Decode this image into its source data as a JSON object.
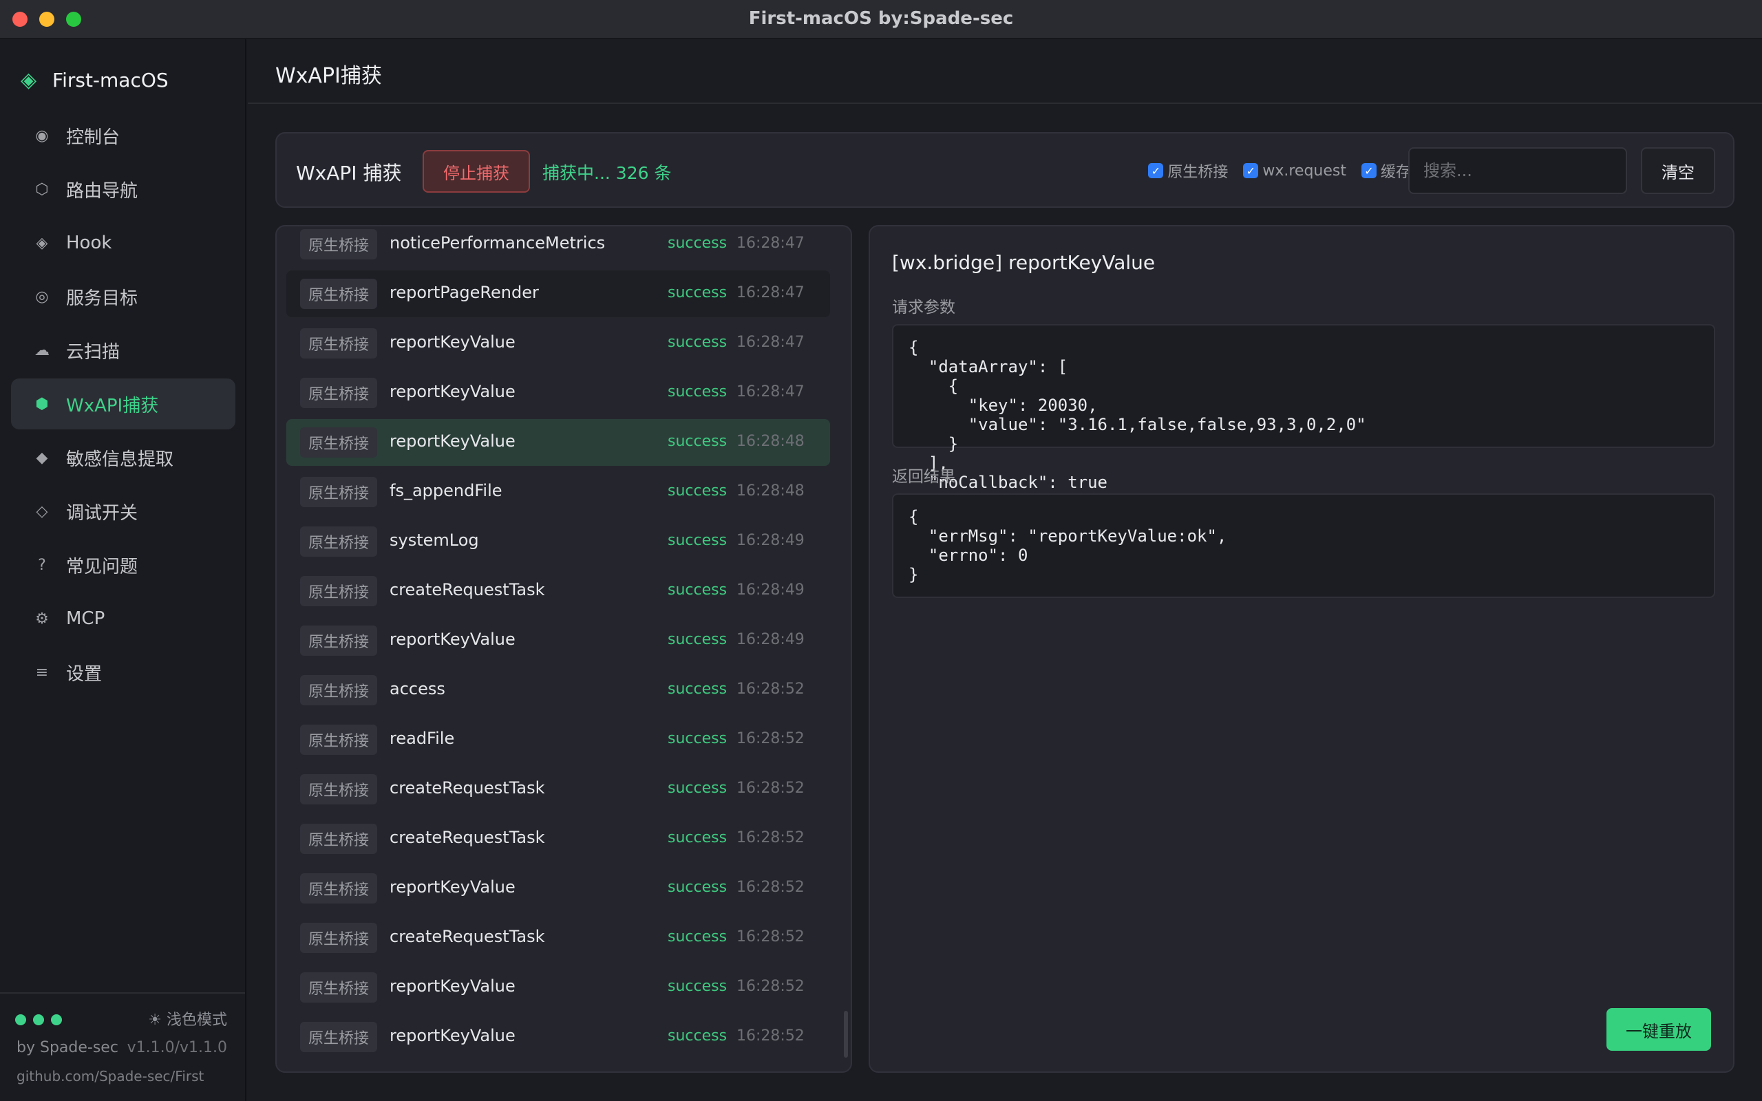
{
  "window": {
    "title": "First-macOS  by:Spade-sec"
  },
  "sidebar": {
    "brand": "First-macOS",
    "items": [
      {
        "label": "控制台",
        "icon": "◉",
        "name": "console"
      },
      {
        "label": "路由导航",
        "icon": "⬡",
        "name": "route-nav"
      },
      {
        "label": "Hook",
        "icon": "◈",
        "name": "hook"
      },
      {
        "label": "服务目标",
        "icon": "◎",
        "name": "service-target"
      },
      {
        "label": "云扫描",
        "icon": "☁",
        "name": "cloud-scan"
      },
      {
        "label": "WxAPI捕获",
        "icon": "⬢",
        "name": "wxapi-capture"
      },
      {
        "label": "敏感信息提取",
        "icon": "◆",
        "name": "sensitive-extract"
      },
      {
        "label": "调试开关",
        "icon": "◇",
        "name": "debug-switch"
      },
      {
        "label": "常见问题",
        "icon": "?",
        "name": "faq"
      },
      {
        "label": "MCP",
        "icon": "⚙",
        "name": "mcp"
      },
      {
        "label": "设置",
        "icon": "≡",
        "name": "settings"
      }
    ],
    "active_index": 5,
    "footer": {
      "theme_toggle": "☀ 浅色模式",
      "by": "by Spade-sec",
      "version": "v1.1.0/v1.1.0",
      "repo": "github.com/Spade-sec/First"
    }
  },
  "header": {
    "title": "WxAPI捕获"
  },
  "toolbar": {
    "title": "WxAPI 捕获",
    "stop_label": "停止捕获",
    "status": "捕获中... 326 条",
    "filters": [
      "原生桥接",
      "wx.request",
      "缓存"
    ],
    "search_placeholder": "搜索...",
    "clear_label": "清空"
  },
  "list": {
    "rows": [
      {
        "tag": "原生桥接",
        "name": "noticePerformanceMetrics",
        "status": "success",
        "time": "16:28:47"
      },
      {
        "tag": "原生桥接",
        "name": "reportPageRender",
        "status": "success",
        "time": "16:28:47"
      },
      {
        "tag": "原生桥接",
        "name": "reportKeyValue",
        "status": "success",
        "time": "16:28:47"
      },
      {
        "tag": "原生桥接",
        "name": "reportKeyValue",
        "status": "success",
        "time": "16:28:47"
      },
      {
        "tag": "原生桥接",
        "name": "reportKeyValue",
        "status": "success",
        "time": "16:28:48"
      },
      {
        "tag": "原生桥接",
        "name": "fs_appendFile",
        "status": "success",
        "time": "16:28:48"
      },
      {
        "tag": "原生桥接",
        "name": "systemLog",
        "status": "success",
        "time": "16:28:49"
      },
      {
        "tag": "原生桥接",
        "name": "createRequestTask",
        "status": "success",
        "time": "16:28:49"
      },
      {
        "tag": "原生桥接",
        "name": "reportKeyValue",
        "status": "success",
        "time": "16:28:49"
      },
      {
        "tag": "原生桥接",
        "name": "access",
        "status": "success",
        "time": "16:28:52"
      },
      {
        "tag": "原生桥接",
        "name": "readFile",
        "status": "success",
        "time": "16:28:52"
      },
      {
        "tag": "原生桥接",
        "name": "createRequestTask",
        "status": "success",
        "time": "16:28:52"
      },
      {
        "tag": "原生桥接",
        "name": "createRequestTask",
        "status": "success",
        "time": "16:28:52"
      },
      {
        "tag": "原生桥接",
        "name": "reportKeyValue",
        "status": "success",
        "time": "16:28:52"
      },
      {
        "tag": "原生桥接",
        "name": "createRequestTask",
        "status": "success",
        "time": "16:28:52"
      },
      {
        "tag": "原生桥接",
        "name": "reportKeyValue",
        "status": "success",
        "time": "16:28:52"
      },
      {
        "tag": "原生桥接",
        "name": "reportKeyValue",
        "status": "success",
        "time": "16:28:52"
      }
    ],
    "hover_index": 1,
    "selected_index": 4
  },
  "detail": {
    "title": "[wx.bridge] reportKeyValue",
    "request_label": "请求参数",
    "request_body": "{\n  \"dataArray\": [\n    {\n      \"key\": 20030,\n      \"value\": \"3.16.1,false,false,93,3,0,2,0\"\n    }\n  ],\n  \"noCallback\": true\n}",
    "response_label": "返回结果",
    "response_body": "{\n  \"errMsg\": \"reportKeyValue:ok\",\n  \"errno\": 0\n}",
    "replay_label": "一键重放"
  }
}
